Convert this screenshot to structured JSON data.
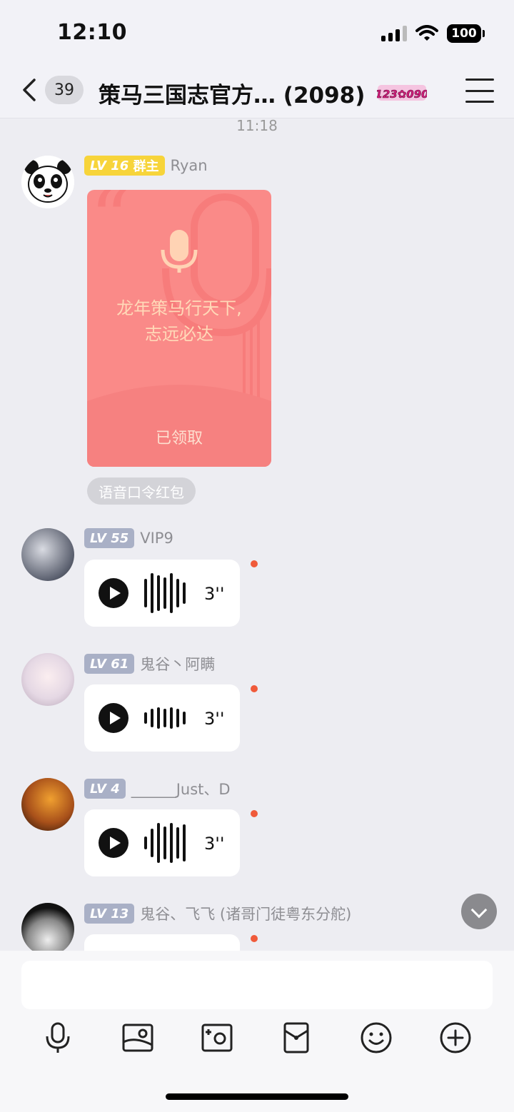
{
  "status_bar": {
    "time": "12:10",
    "battery": "100"
  },
  "header": {
    "unread_count": "39",
    "title": "策马三国志官方… (2098)",
    "tag_text": "123✿090"
  },
  "chat": {
    "time_divider": "11:18",
    "messages": [
      {
        "level": "LV 16",
        "role": "群主",
        "nickname": "Ryan",
        "red_packet": {
          "phrase_line1": "龙年策马行天下,",
          "phrase_line2": "志远必达",
          "status": "已领取",
          "type_label": "语音口令红包"
        }
      },
      {
        "level": "LV 55",
        "nickname": "VIP9",
        "duration": "3''"
      },
      {
        "level": "LV 61",
        "nickname": "鬼谷丶阿瞒",
        "duration": "3''"
      },
      {
        "level": "LV 4",
        "nickname": "______Just、D",
        "duration": "3''"
      },
      {
        "level": "LV 13",
        "nickname": "鬼谷、飞飞 (诸哥门徒粤东分舵)"
      }
    ]
  },
  "input": {
    "placeholder": ""
  },
  "toolbar": [
    "mic-icon",
    "image-icon",
    "camera-icon",
    "red-packet-icon",
    "emoji-icon",
    "plus-icon"
  ],
  "colors": {
    "accent_red": "#f05a3a",
    "red_packet": "#fa8a88",
    "level_gold": "#f7d43a",
    "level_gray": "#a9b0c6"
  }
}
